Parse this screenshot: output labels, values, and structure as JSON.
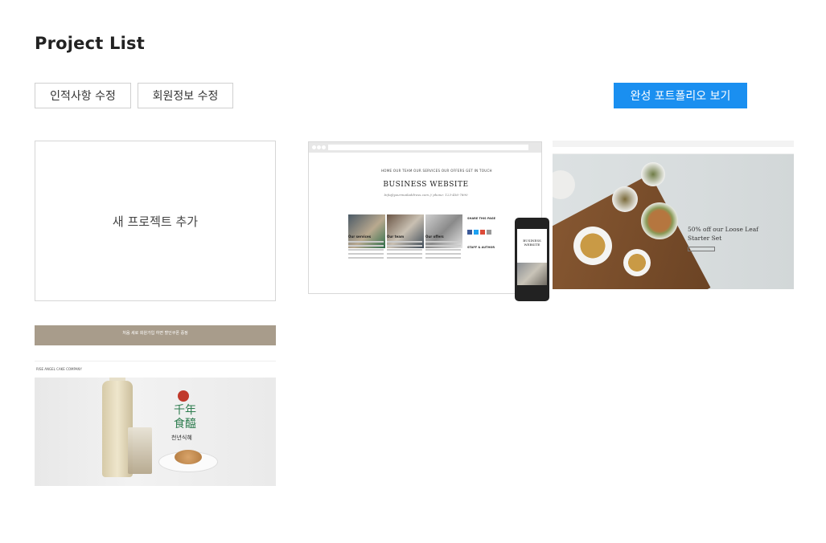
{
  "page": {
    "title": "Project List"
  },
  "toolbar": {
    "personal_info_label": "인적사항 수정",
    "member_info_label": "회원정보 수정",
    "view_portfolio_label": "완성 포트폴리오 보기"
  },
  "projects": {
    "new_project_label": "새 프로젝트 추가",
    "items": [
      {
        "nav": "HOME    OUR TEAM    OUR SERVICES    OUR OFFERS    GET IN TOUCH",
        "title": "BUSINESS WEBSITE",
        "subtitle": "Info@yourmailaddress.com // phone: 123-456-7890",
        "columns": [
          "Our services",
          "Our team",
          "Our offers"
        ],
        "side_labels": [
          "SHARE THIS PAGE",
          "STAFF & AUTHOR"
        ],
        "phone_title": "BUSINESS WEBSITE"
      },
      {
        "hero_text": [
          "50% off our Loose Leaf",
          "Starter Set"
        ]
      },
      {
        "promo": "처음 세로 회원가입 하면 할인쿠폰 증정",
        "brand": "RISE ANGEL CAKE COMPANY",
        "hero_hanja": "千年\n食醯",
        "hero_korean": "천년식혜"
      }
    ]
  },
  "colors": {
    "accent": "#1a8ff0",
    "border": "#cfcfcf"
  }
}
